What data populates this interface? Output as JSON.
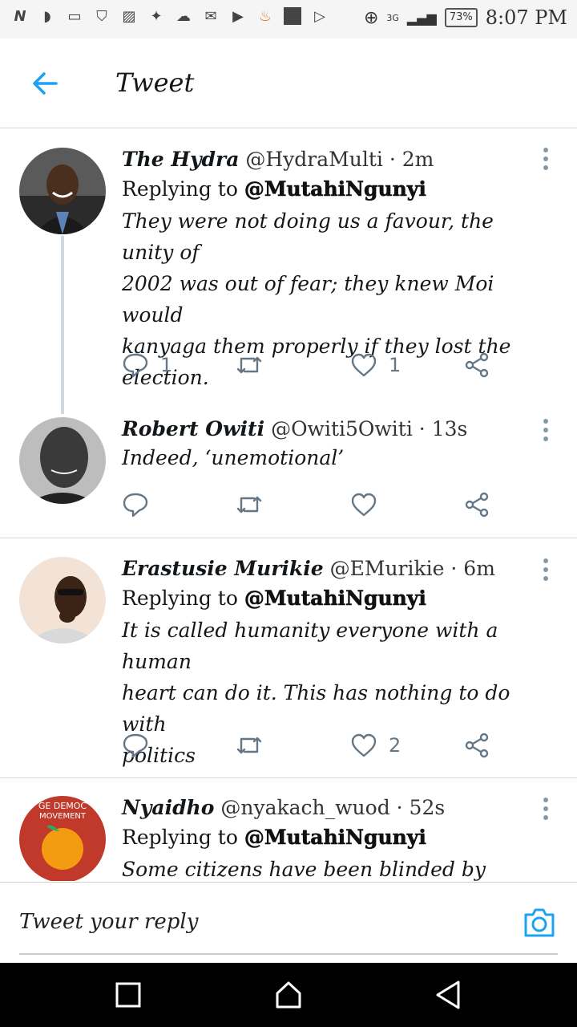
{
  "status_bar": {
    "battery": "73%",
    "time": "8:07 PM",
    "network": "3G"
  },
  "header": {
    "title": "Tweet"
  },
  "tweets": [
    {
      "name": "The Hydra",
      "handle": "@HydraMulti",
      "time": "· 2m",
      "replying_prefix": "Replying to",
      "replying_to": "@MutahiNgunyi",
      "lines": [
        "They were not doing us a favour, the unity of",
        "2002 was out of fear; they knew Moi would",
        "kanyaga them properly if they lost the",
        "election."
      ],
      "replies": "1",
      "likes": "1"
    },
    {
      "name": "Robert Owiti",
      "handle": "@Owiti5Owiti",
      "time": "· 13s",
      "lines": [
        "Indeed, ‘unemotional’"
      ]
    },
    {
      "name": "Erastusie Murikie",
      "handle": "@EMurikie",
      "time": "· 6m",
      "replying_prefix": "Replying to",
      "replying_to": "@MutahiNgunyi",
      "lines": [
        "It is called humanity everyone with a human",
        "heart can do it. This has nothing to do with",
        "politics"
      ],
      "likes": "2"
    },
    {
      "name": "Nyaidho",
      "handle": "@nyakach_wuod",
      "time": "· 52s",
      "replying_prefix": "Replying to",
      "replying_to": "@MutahiNgunyi",
      "lines": [
        "Some citizens have been blinded by cheap"
      ],
      "avatar_text": [
        "GE DEMOC",
        "MOVEMENT"
      ]
    }
  ],
  "reply_bar": {
    "placeholder": "Tweet your reply"
  },
  "colors": {
    "accent": "#1da1f2",
    "icon_gray": "#657786"
  }
}
